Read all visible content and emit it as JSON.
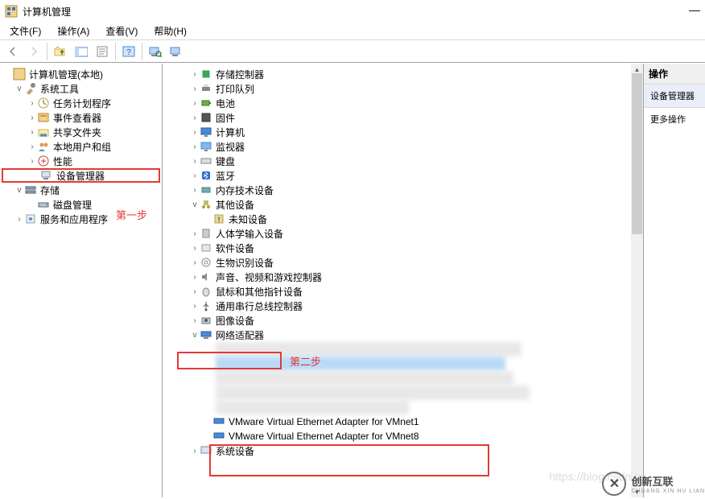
{
  "window": {
    "title": "计算机管理",
    "minimize": "—"
  },
  "menu": {
    "file": "文件(F)",
    "action": "操作(A)",
    "view": "查看(V)",
    "help": "帮助(H)"
  },
  "left_tree": {
    "root": "计算机管理(本地)",
    "system_tools": "系统工具",
    "task_scheduler": "任务计划程序",
    "event_viewer": "事件查看器",
    "shared_folders": "共享文件夹",
    "local_users": "本地用户和组",
    "performance": "性能",
    "device_manager": "设备管理器",
    "storage": "存储",
    "disk_mgmt": "磁盘管理",
    "services_apps": "服务和应用程序"
  },
  "center_tree": {
    "storage_ctrl": "存储控制器",
    "print_queue": "打印队列",
    "battery": "电池",
    "firmware": "固件",
    "computer": "计算机",
    "monitor": "监视器",
    "keyboard": "键盘",
    "bluetooth": "蓝牙",
    "memory_tech": "内存技术设备",
    "other_devices": "其他设备",
    "unknown": "未知设备",
    "hid": "人体学输入设备",
    "software_dev": "软件设备",
    "biometric": "生物识别设备",
    "sound": "声音、视频和游戏控制器",
    "mouse": "鼠标和其他指针设备",
    "usb": "通用串行总线控制器",
    "imaging": "图像设备",
    "network": "网络适配器",
    "vmnet1": "VMware Virtual Ethernet Adapter for VMnet1",
    "vmnet8": "VMware Virtual Ethernet Adapter for VMnet8",
    "system_dev": "系统设备"
  },
  "annotations": {
    "step1": "第一步",
    "step2": "第二步"
  },
  "right": {
    "header": "操作",
    "device_mgr": "设备管理器",
    "more": "更多操作"
  },
  "watermark": {
    "brand": "创新互联",
    "sub": "CHUANG XIN HU LIAN",
    "url": "https://blog.csdn.n"
  }
}
